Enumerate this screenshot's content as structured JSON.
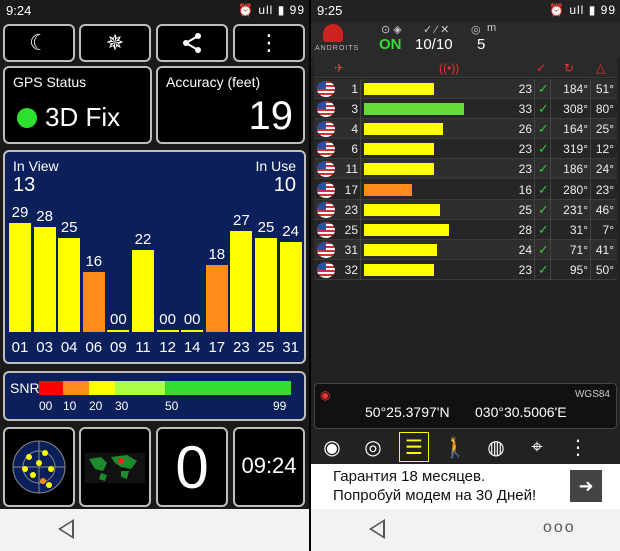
{
  "left": {
    "status": {
      "time": "9:24",
      "battery": "99",
      "signal_label": "ull"
    },
    "toolbar": {
      "night_icon": "moon-icon",
      "compass_icon": "compass-rose-icon",
      "share_icon": "share-icon",
      "menu_icon": "more-vertical-icon"
    },
    "gps_status": {
      "label": "GPS Status",
      "value": "3D Fix",
      "dot_color": "#2ee02e"
    },
    "accuracy": {
      "label": "Accuracy (feet)",
      "value": "19"
    },
    "satellites": {
      "in_view_label": "In View",
      "in_view": "13",
      "in_use_label": "In Use",
      "in_use": "10"
    },
    "chart_data": {
      "type": "bar",
      "categories": [
        "01",
        "03",
        "04",
        "06",
        "09",
        "11",
        "12",
        "14",
        "17",
        "23",
        "25",
        "31"
      ],
      "values": [
        29,
        28,
        25,
        16,
        0,
        22,
        0,
        0,
        18,
        27,
        25,
        24
      ],
      "value_labels": [
        "29",
        "28",
        "25",
        "16",
        "00",
        "22",
        "00",
        "00",
        "18",
        "27",
        "25",
        "24"
      ],
      "colors": [
        "#ffff00",
        "#ffff00",
        "#ffff00",
        "#ff8c1a",
        "#ffff00",
        "#ffff00",
        "#ffff00",
        "#ffff00",
        "#ff8c1a",
        "#ffff00",
        "#ffff00",
        "#ffff00"
      ],
      "ylim": [
        0,
        40
      ]
    },
    "snr": {
      "label": "SNR",
      "ticks": [
        "00",
        "10",
        "20",
        "30",
        "50",
        "99"
      ],
      "colors": [
        "#ff0000",
        "#ff8c1a",
        "#ffff00",
        "#aaff44",
        "#33dd33"
      ]
    },
    "bottom": {
      "radar_icon": "sky-plot-icon",
      "map_icon": "world-map-icon",
      "count": "0",
      "clock": "09:24"
    }
  },
  "right": {
    "status": {
      "time": "9:25",
      "battery": "99",
      "signal_label": "ull"
    },
    "header": {
      "logo_text": "ANDROITS",
      "gps_state": "ON",
      "sats": "10/10",
      "count": "5",
      "unit": "m"
    },
    "columns": {
      "sat_icon": "satellite-icon",
      "signal_icon": "signal-wave-icon",
      "used_icon": "check-icon",
      "azimuth_icon": "azimuth-icon",
      "elevation_icon": "elevation-icon"
    },
    "rows": [
      {
        "prn": "1",
        "snr": "23",
        "snr_value": 23,
        "color": "#ffff00",
        "used": "✓",
        "az": "184°",
        "el": "51°"
      },
      {
        "prn": "3",
        "snr": "33",
        "snr_value": 33,
        "color": "#66dd33",
        "used": "✓",
        "az": "308°",
        "el": "80°"
      },
      {
        "prn": "4",
        "snr": "26",
        "snr_value": 26,
        "color": "#ffff00",
        "used": "✓",
        "az": "164°",
        "el": "25°"
      },
      {
        "prn": "6",
        "snr": "23",
        "snr_value": 23,
        "color": "#ffff00",
        "used": "✓",
        "az": "319°",
        "el": "12°"
      },
      {
        "prn": "11",
        "snr": "23",
        "snr_value": 23,
        "color": "#ffff00",
        "used": "✓",
        "az": "186°",
        "el": "24°"
      },
      {
        "prn": "17",
        "snr": "16",
        "snr_value": 16,
        "color": "#ff8c1a",
        "used": "✓",
        "az": "280°",
        "el": "23°"
      },
      {
        "prn": "23",
        "snr": "25",
        "snr_value": 25,
        "color": "#ffff00",
        "used": "✓",
        "az": "231°",
        "el": "46°"
      },
      {
        "prn": "25",
        "snr": "28",
        "snr_value": 28,
        "color": "#ffff00",
        "used": "✓",
        "az": "31°",
        "el": "7°"
      },
      {
        "prn": "31",
        "snr": "24",
        "snr_value": 24,
        "color": "#ffff00",
        "used": "✓",
        "az": "71°",
        "el": "41°"
      },
      {
        "prn": "32",
        "snr": "23",
        "snr_value": 23,
        "color": "#ffff00",
        "used": "✓",
        "az": "95°",
        "el": "50°"
      }
    ],
    "coords": {
      "datum": "WGS84",
      "lat": "50°25.3797'N",
      "lon": "030°30.5006'E"
    },
    "tools": [
      "compass-icon",
      "radar-icon",
      "satellite-list-icon",
      "walker-icon",
      "globe-icon",
      "location-pin-icon",
      "more-vertical-icon"
    ],
    "ad": {
      "line1": "Гарантия 18 месяцев.",
      "line2": "Попробуй модем на 30 Дней!"
    }
  }
}
